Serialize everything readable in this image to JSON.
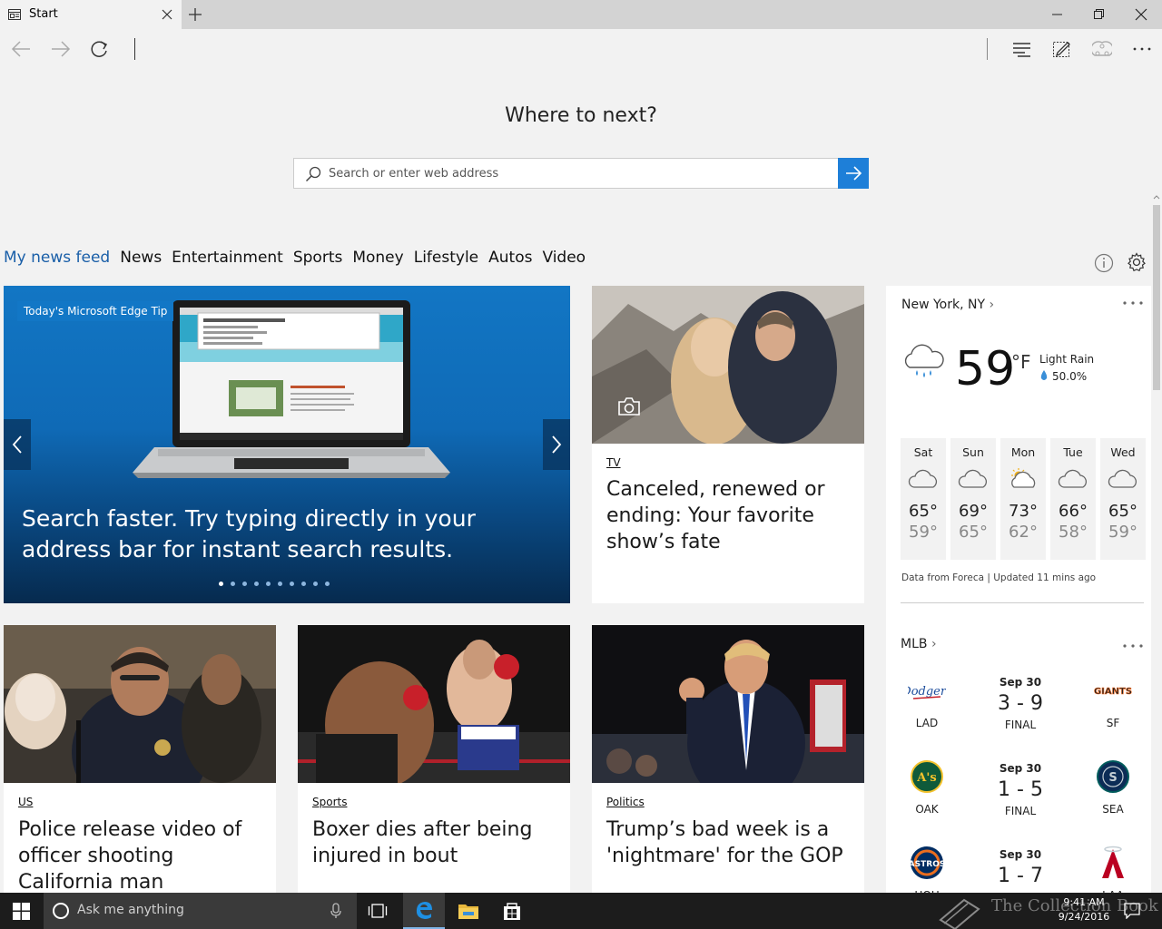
{
  "browser": {
    "tab_title": "Start",
    "new_tab_symbol": "+"
  },
  "page": {
    "heading": "Where to next?",
    "search_placeholder": "Search or enter web address"
  },
  "categories": [
    "My news feed",
    "News",
    "Entertainment",
    "Sports",
    "Money",
    "Lifestyle",
    "Autos",
    "Video"
  ],
  "hero": {
    "badge": "Today's Microsoft Edge Tip",
    "headline": "Search faster. Try typing directly in your address bar for instant search results.",
    "dot_count": 10,
    "active_dot": 1
  },
  "cards": [
    {
      "category": "TV",
      "title": "Canceled, renewed or ending: Your favorite show’s fate"
    },
    {
      "category": "US",
      "title": "Police release video of officer shooting California man"
    },
    {
      "category": "Sports",
      "title": "Boxer dies after being injured in bout"
    },
    {
      "category": "Politics",
      "title": "Trump’s bad week is a 'nightmare' for the GOP"
    }
  ],
  "weather": {
    "location": "New York, NY",
    "temp": "59",
    "unit": "°F",
    "condition": "Light Rain",
    "precip": "50.0%",
    "forecast": [
      {
        "day": "Sat",
        "high": "65°",
        "low": "59°",
        "icon": "cloud-icon"
      },
      {
        "day": "Sun",
        "high": "69°",
        "low": "65°",
        "icon": "cloud-icon"
      },
      {
        "day": "Mon",
        "high": "73°",
        "low": "62°",
        "icon": "partly-sunny-icon"
      },
      {
        "day": "Tue",
        "high": "66°",
        "low": "58°",
        "icon": "cloud-icon"
      },
      {
        "day": "Wed",
        "high": "65°",
        "low": "59°",
        "icon": "cloud-icon"
      }
    ],
    "source": "Data from Foreca | Updated 11 mins ago"
  },
  "mlb": {
    "title": "MLB",
    "games": [
      {
        "away_logo": "Dodgers",
        "away": "LAD",
        "date": "Sep 30",
        "score": "3 - 9",
        "status": "FINAL",
        "home_logo": "GIANTS",
        "home": "SF"
      },
      {
        "away_logo": "A's",
        "away": "OAK",
        "date": "Sep 30",
        "score": "1 - 5",
        "status": "FINAL",
        "home_logo": "S",
        "home": "SEA"
      },
      {
        "away_logo": "Astros",
        "away": "HOU",
        "date": "Sep 30",
        "score": "1 - 7",
        "status": "",
        "home_logo": "A",
        "home": "LAA"
      }
    ]
  },
  "taskbar": {
    "search_placeholder": "Ask me anything",
    "time": "9:41 AM",
    "date": "9/24/2016",
    "watermark": "The Collection Book"
  },
  "colors": {
    "accent": "#1e7fd8",
    "active_category": "#1a5fa8",
    "taskbar": "#1c1c1c"
  }
}
